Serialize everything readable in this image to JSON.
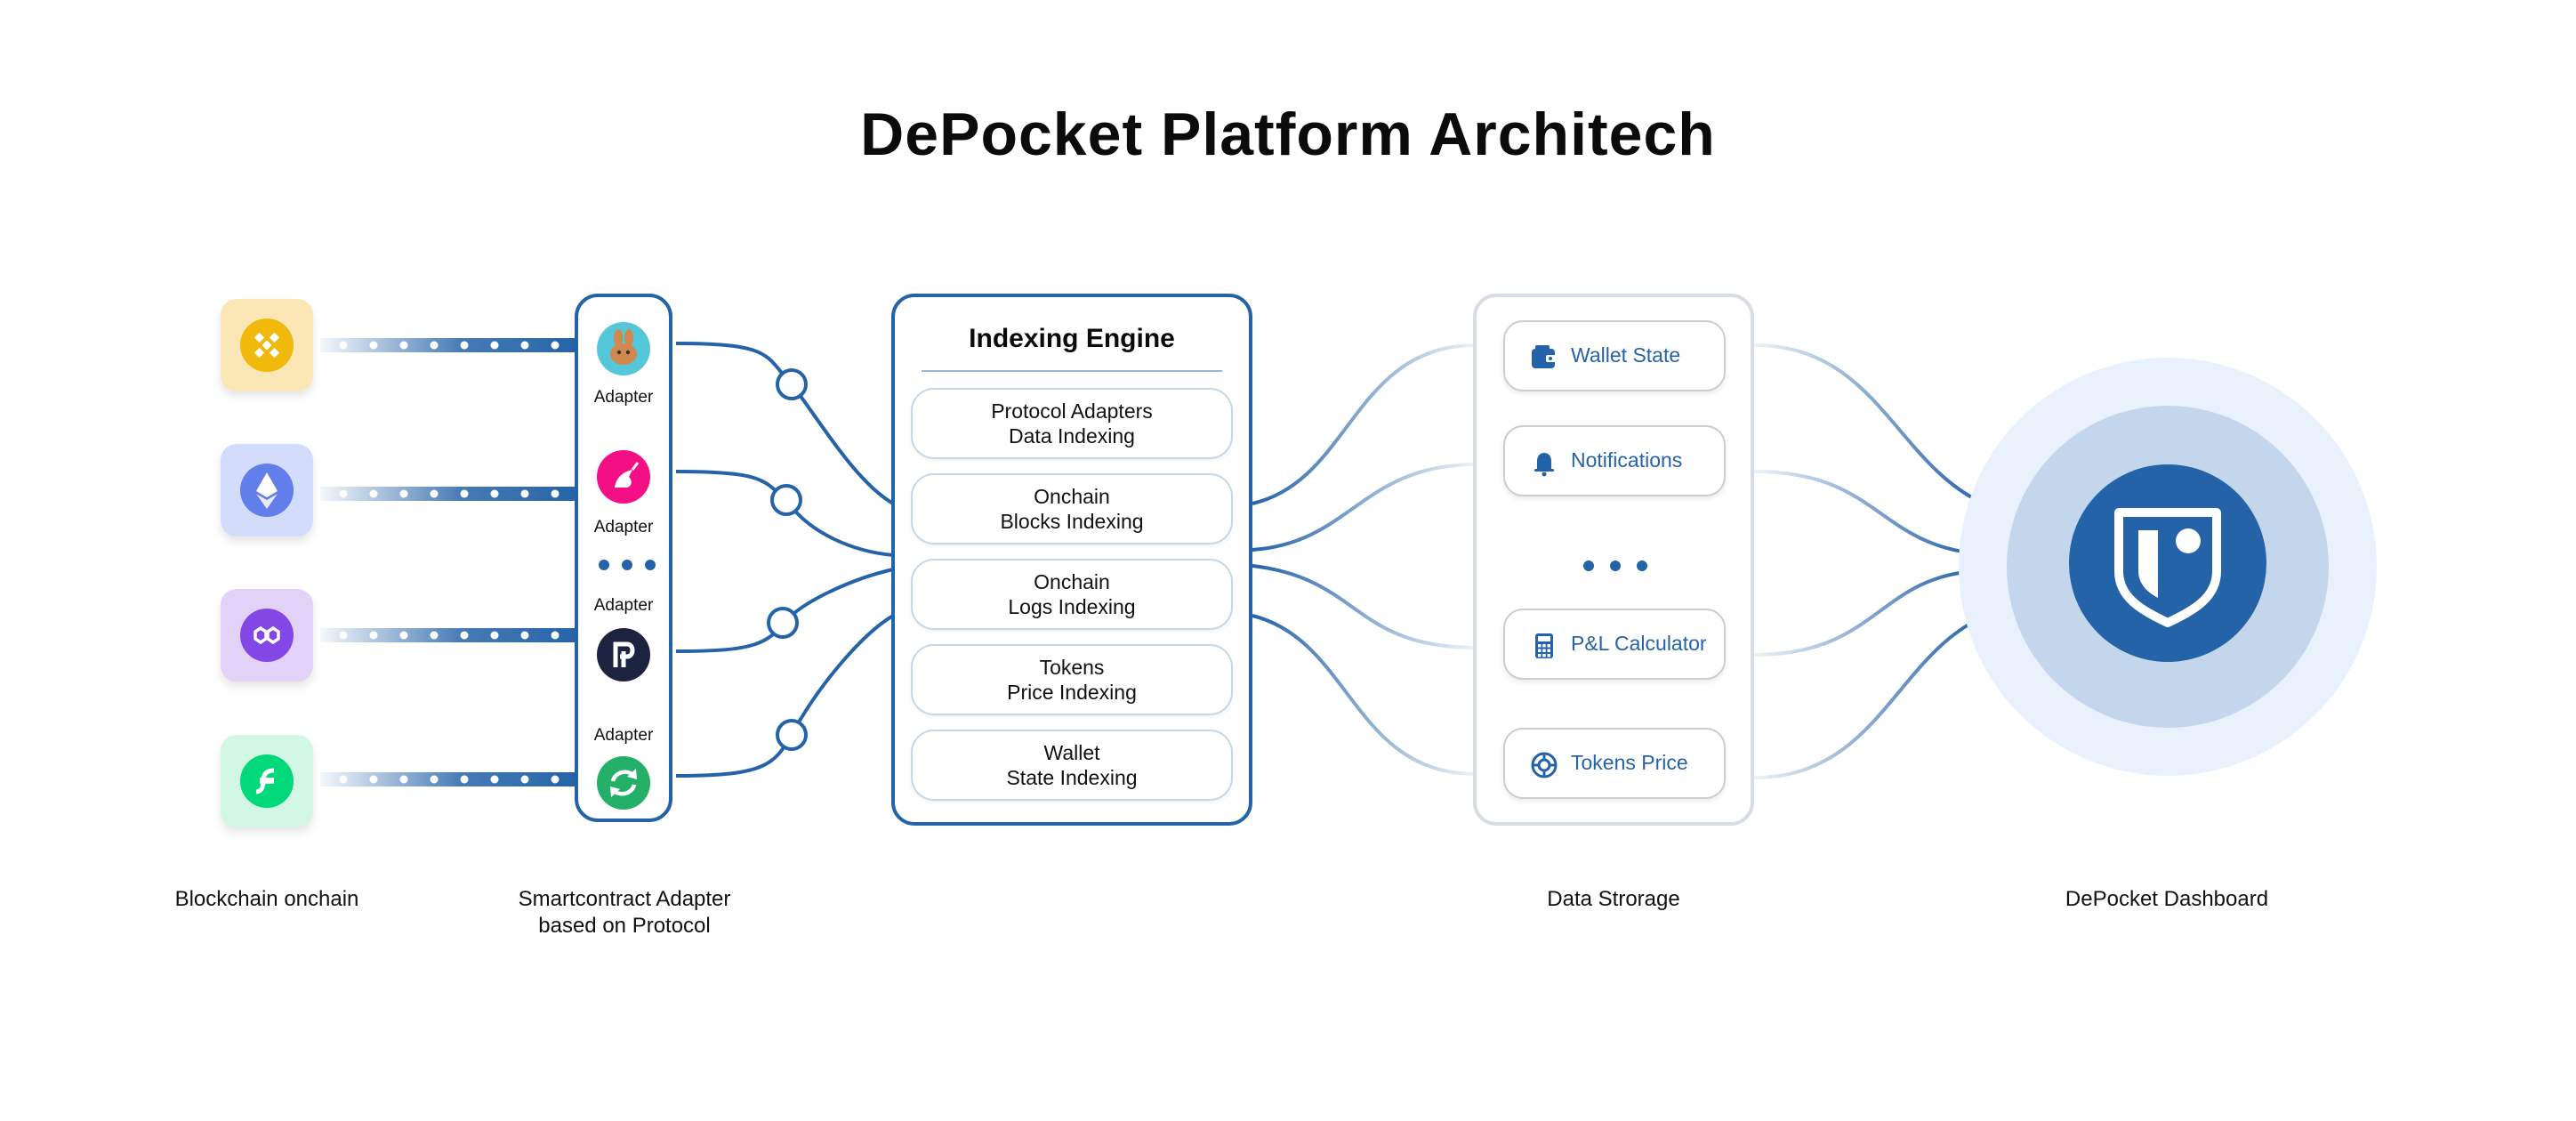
{
  "title": "DePocket Platform Architech",
  "colors": {
    "primary": "#2563a8",
    "binance_tile": "#fbe7b6",
    "ethereum_tile": "#d4dcfb",
    "polygon_tile": "#e3d2f7",
    "flow_tile": "#d2f7e4"
  },
  "chains": [
    {
      "name": "binance",
      "icon": "binance-icon"
    },
    {
      "name": "ethereum",
      "icon": "ethereum-icon"
    },
    {
      "name": "polygon",
      "icon": "polygon-icon"
    },
    {
      "name": "flow",
      "icon": "flow-icon"
    }
  ],
  "adapters": {
    "labels": [
      "Adapter",
      "Adapter",
      "Adapter",
      "Adapter"
    ],
    "protocols": [
      "pancakeswap-icon",
      "unicorn-icon",
      "protocol-p-icon",
      "swap-arrows-icon"
    ]
  },
  "engine": {
    "title": "Indexing Engine",
    "items": [
      {
        "line1": "Protocol Adapters",
        "line2": "Data Indexing"
      },
      {
        "line1": "Onchain",
        "line2": "Blocks Indexing"
      },
      {
        "line1": "Onchain",
        "line2": "Logs Indexing"
      },
      {
        "line1": "Tokens",
        "line2": "Price Indexing"
      },
      {
        "line1": "Wallet",
        "line2": "State Indexing"
      }
    ]
  },
  "storage": {
    "items": [
      {
        "label": "Wallet State",
        "icon": "wallet-icon"
      },
      {
        "label": "Notifications",
        "icon": "bell-icon"
      },
      {
        "label": "P&L Calculator",
        "icon": "calculator-icon"
      },
      {
        "label": "Tokens Price",
        "icon": "token-icon"
      }
    ]
  },
  "captions": {
    "chains": "Blockchain onchain",
    "adapters_line1": "Smartcontract Adapter",
    "adapters_line2": "based on Protocol",
    "storage": "Data Strorage",
    "dashboard": "DePocket Dashboard"
  },
  "dashboard": {
    "icon": "depocket-logo-icon"
  }
}
